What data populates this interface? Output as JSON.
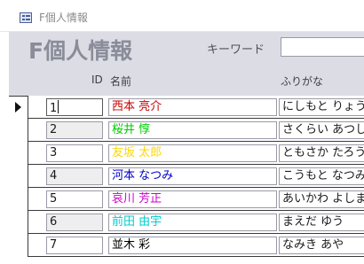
{
  "window": {
    "title": "F個人情報",
    "icon": "form-icon"
  },
  "header": {
    "title": "F個人情報",
    "keyword_label": "キーワード",
    "keyword_value": "",
    "columns": {
      "id": "ID",
      "name": "名前",
      "kana": "ふりがな"
    }
  },
  "records": [
    {
      "id": "1",
      "name": "西本 亮介",
      "kana": "にしもと りょうすけ",
      "name_color": "#cc0000"
    },
    {
      "id": "2",
      "name": "桜井 惇",
      "kana": "さくらい あつし",
      "name_color": "#00cc00"
    },
    {
      "id": "3",
      "name": "友坂 太郎",
      "kana": "ともさか たろう",
      "name_color": "#ffd700"
    },
    {
      "id": "4",
      "name": "河本 なつみ",
      "kana": "こうもと なつみ",
      "name_color": "#0000cc"
    },
    {
      "id": "5",
      "name": "哀川 芳正",
      "kana": "あいかわ よしまさ",
      "name_color": "#cc00cc"
    },
    {
      "id": "6",
      "name": "前田 由宇",
      "kana": "まえだ ゆう",
      "name_color": "#00cccc"
    },
    {
      "id": "7",
      "name": "並木 彩",
      "kana": "なみき あや",
      "name_color": "#000000"
    }
  ],
  "current_record_index": 0,
  "colors": {
    "header_bg": "#dcdde4",
    "title_text": "#8a8c99",
    "alt_row_id_bg": "#eeeeee"
  }
}
